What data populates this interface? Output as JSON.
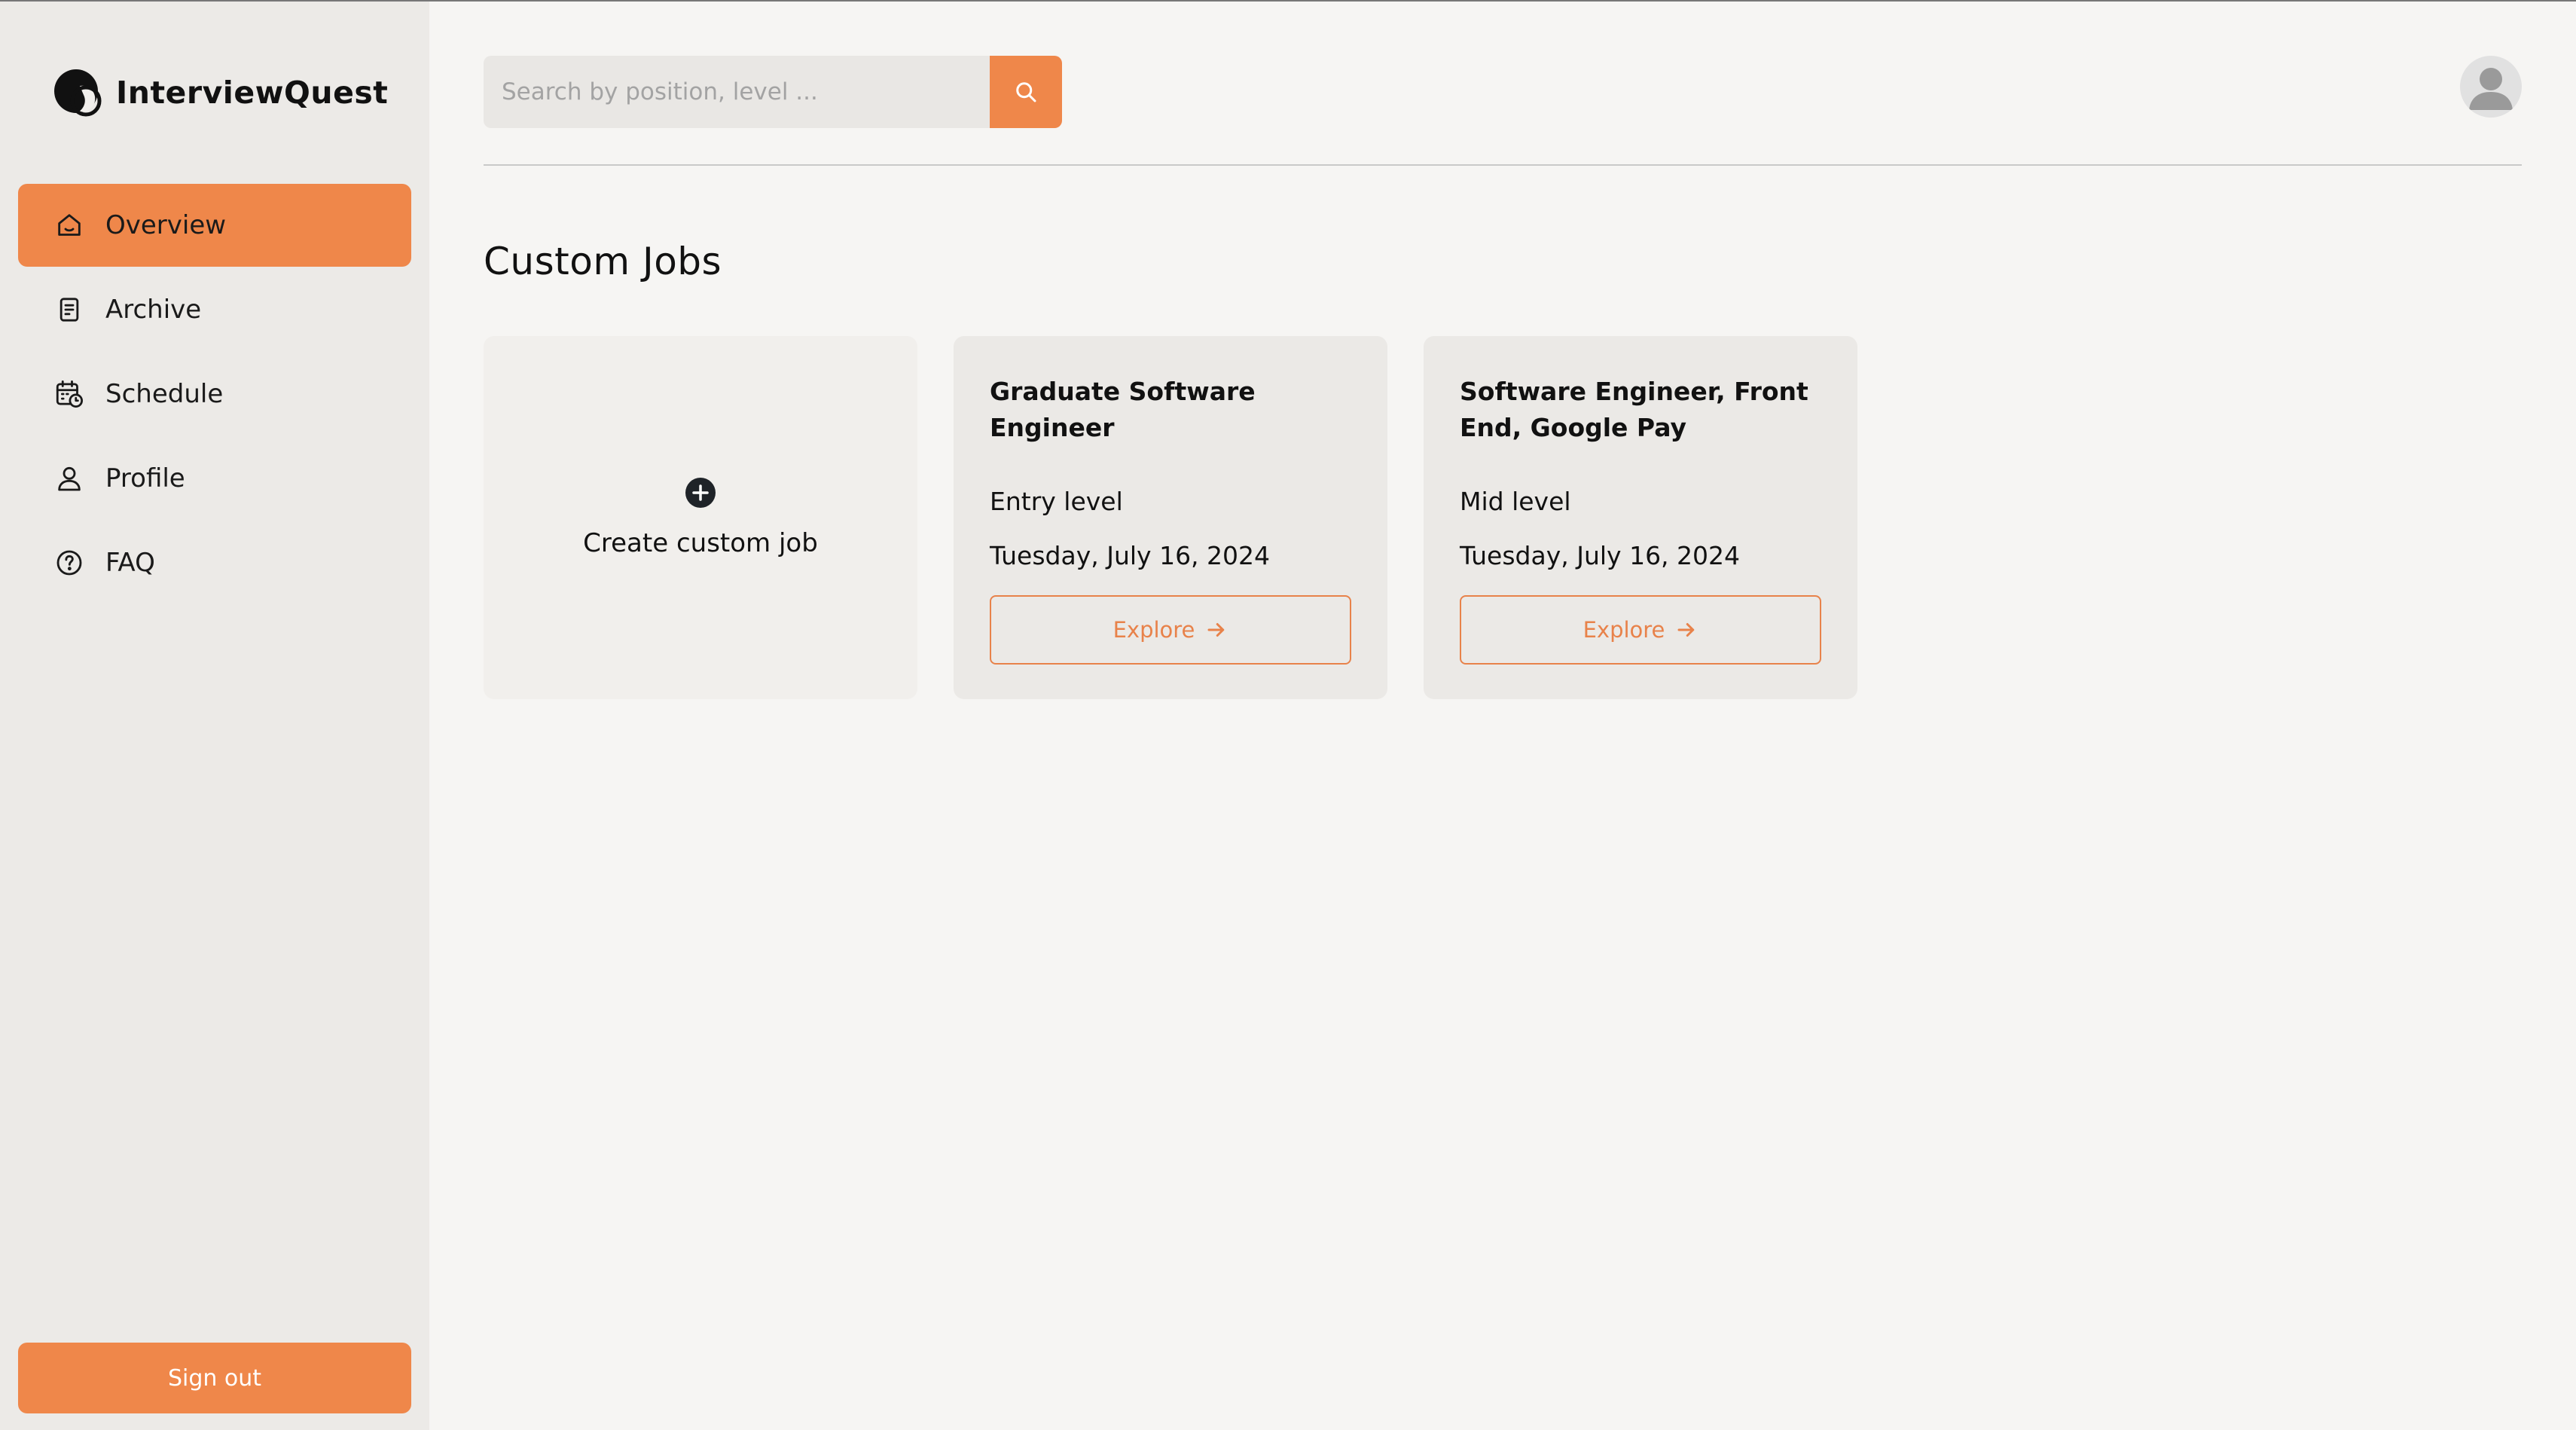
{
  "app": {
    "name": "InterviewQuest"
  },
  "sidebar": {
    "items": [
      {
        "label": "Overview",
        "icon": "home-icon",
        "active": true
      },
      {
        "label": "Archive",
        "icon": "document-icon",
        "active": false
      },
      {
        "label": "Schedule",
        "icon": "calendar-clock-icon",
        "active": false
      },
      {
        "label": "Profile",
        "icon": "user-icon",
        "active": false
      },
      {
        "label": "FAQ",
        "icon": "question-icon",
        "active": false
      }
    ],
    "signout_label": "Sign out"
  },
  "header": {
    "search_placeholder": "Search by position, level ...",
    "search_value": ""
  },
  "main": {
    "title": "Custom Jobs",
    "create_label": "Create custom job",
    "jobs": [
      {
        "title": "Graduate Software Engineer",
        "level": "Entry level",
        "date": "Tuesday, July 16, 2024",
        "action_label": "Explore"
      },
      {
        "title": "Software Engineer, Front End, Google Pay",
        "level": "Mid level",
        "date": "Tuesday, July 16, 2024",
        "action_label": "Explore"
      }
    ]
  },
  "colors": {
    "accent": "#ef874a",
    "sidebar_bg": "#eceae7",
    "page_bg": "#f6f5f3",
    "card_bg": "#ebe9e6"
  }
}
